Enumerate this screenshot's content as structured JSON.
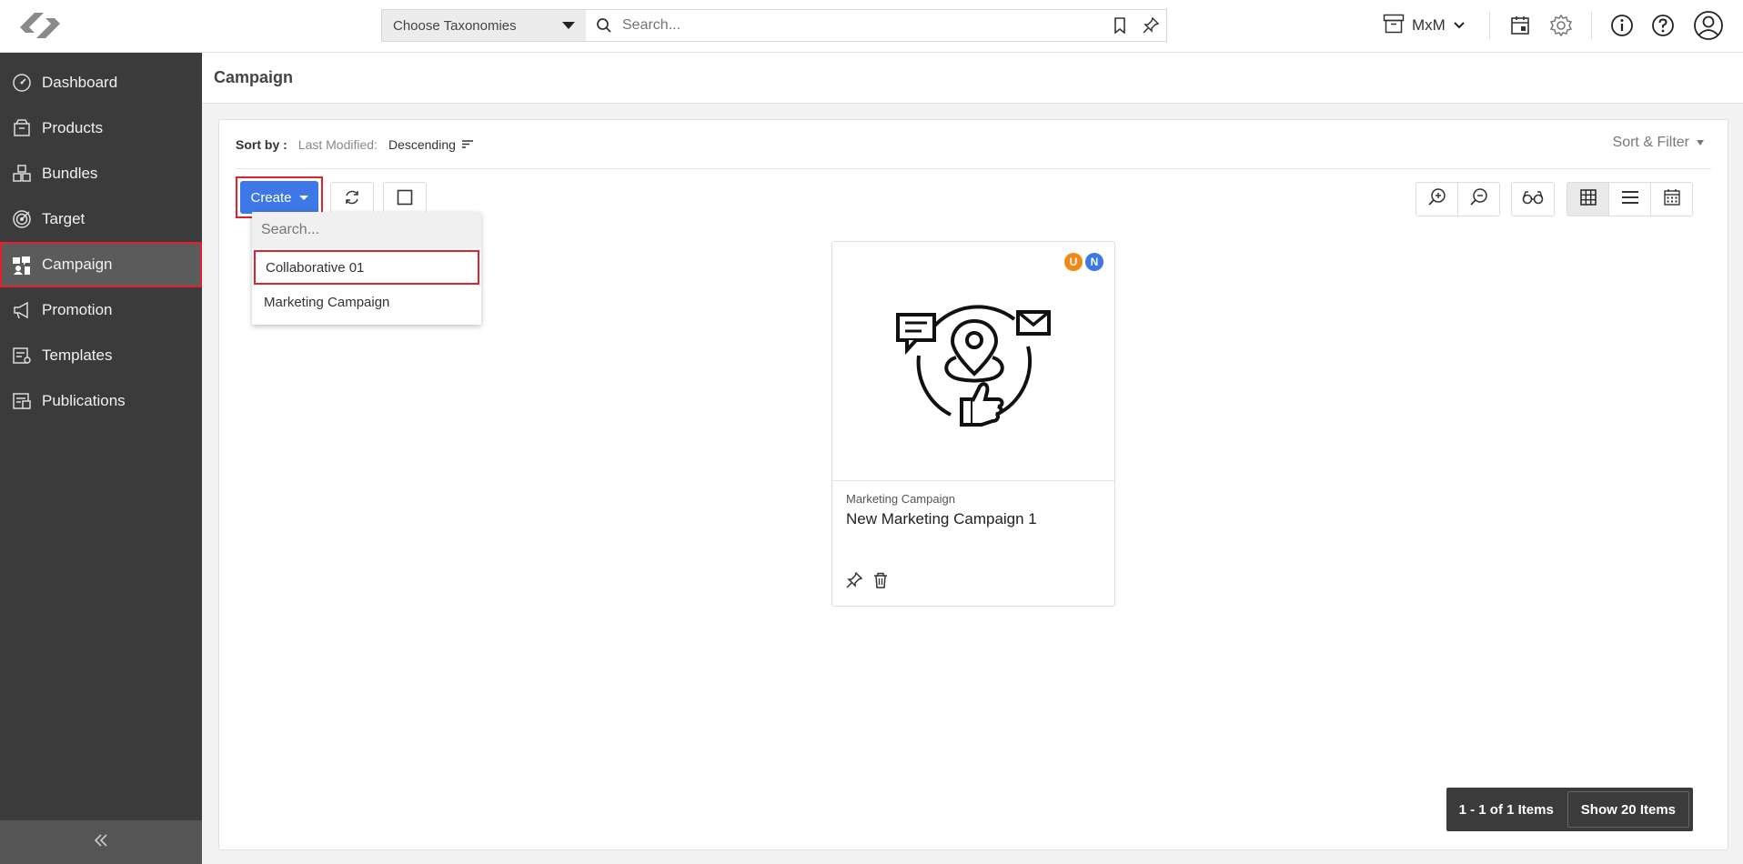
{
  "header": {
    "taxonomy_label": "Choose Taxonomies",
    "search_placeholder": "Search...",
    "workspace": "MxM"
  },
  "sidebar": {
    "items": [
      {
        "label": "Dashboard",
        "icon": "speedometer-icon"
      },
      {
        "label": "Products",
        "icon": "box-icon"
      },
      {
        "label": "Bundles",
        "icon": "boxes-icon"
      },
      {
        "label": "Target",
        "icon": "target-icon"
      },
      {
        "label": "Campaign",
        "icon": "campaign-icon",
        "active": true
      },
      {
        "label": "Promotion",
        "icon": "megaphone-icon"
      },
      {
        "label": "Templates",
        "icon": "template-icon"
      },
      {
        "label": "Publications",
        "icon": "publication-icon"
      }
    ]
  },
  "page": {
    "title": "Campaign"
  },
  "sort": {
    "label": "Sort by :",
    "key": "Last Modified:",
    "value": "Descending",
    "filter_label": "Sort & Filter"
  },
  "toolbar": {
    "create_label": "Create"
  },
  "dropdown": {
    "search_placeholder": "Search...",
    "items": [
      "Collaborative 01",
      "Marketing Campaign"
    ]
  },
  "card": {
    "type": "Marketing Campaign",
    "name": "New Marketing Campaign 1",
    "badges": [
      {
        "text": "U",
        "color": "#ef8a1a"
      },
      {
        "text": "N",
        "color": "#3d77e8"
      }
    ]
  },
  "pagination": {
    "count": "1 - 1 of 1 Items",
    "show": "Show 20 Items"
  },
  "colors": {
    "accent": "#3d77e8",
    "highlight": "#e5202e",
    "sidebar": "#3b3b3b"
  }
}
